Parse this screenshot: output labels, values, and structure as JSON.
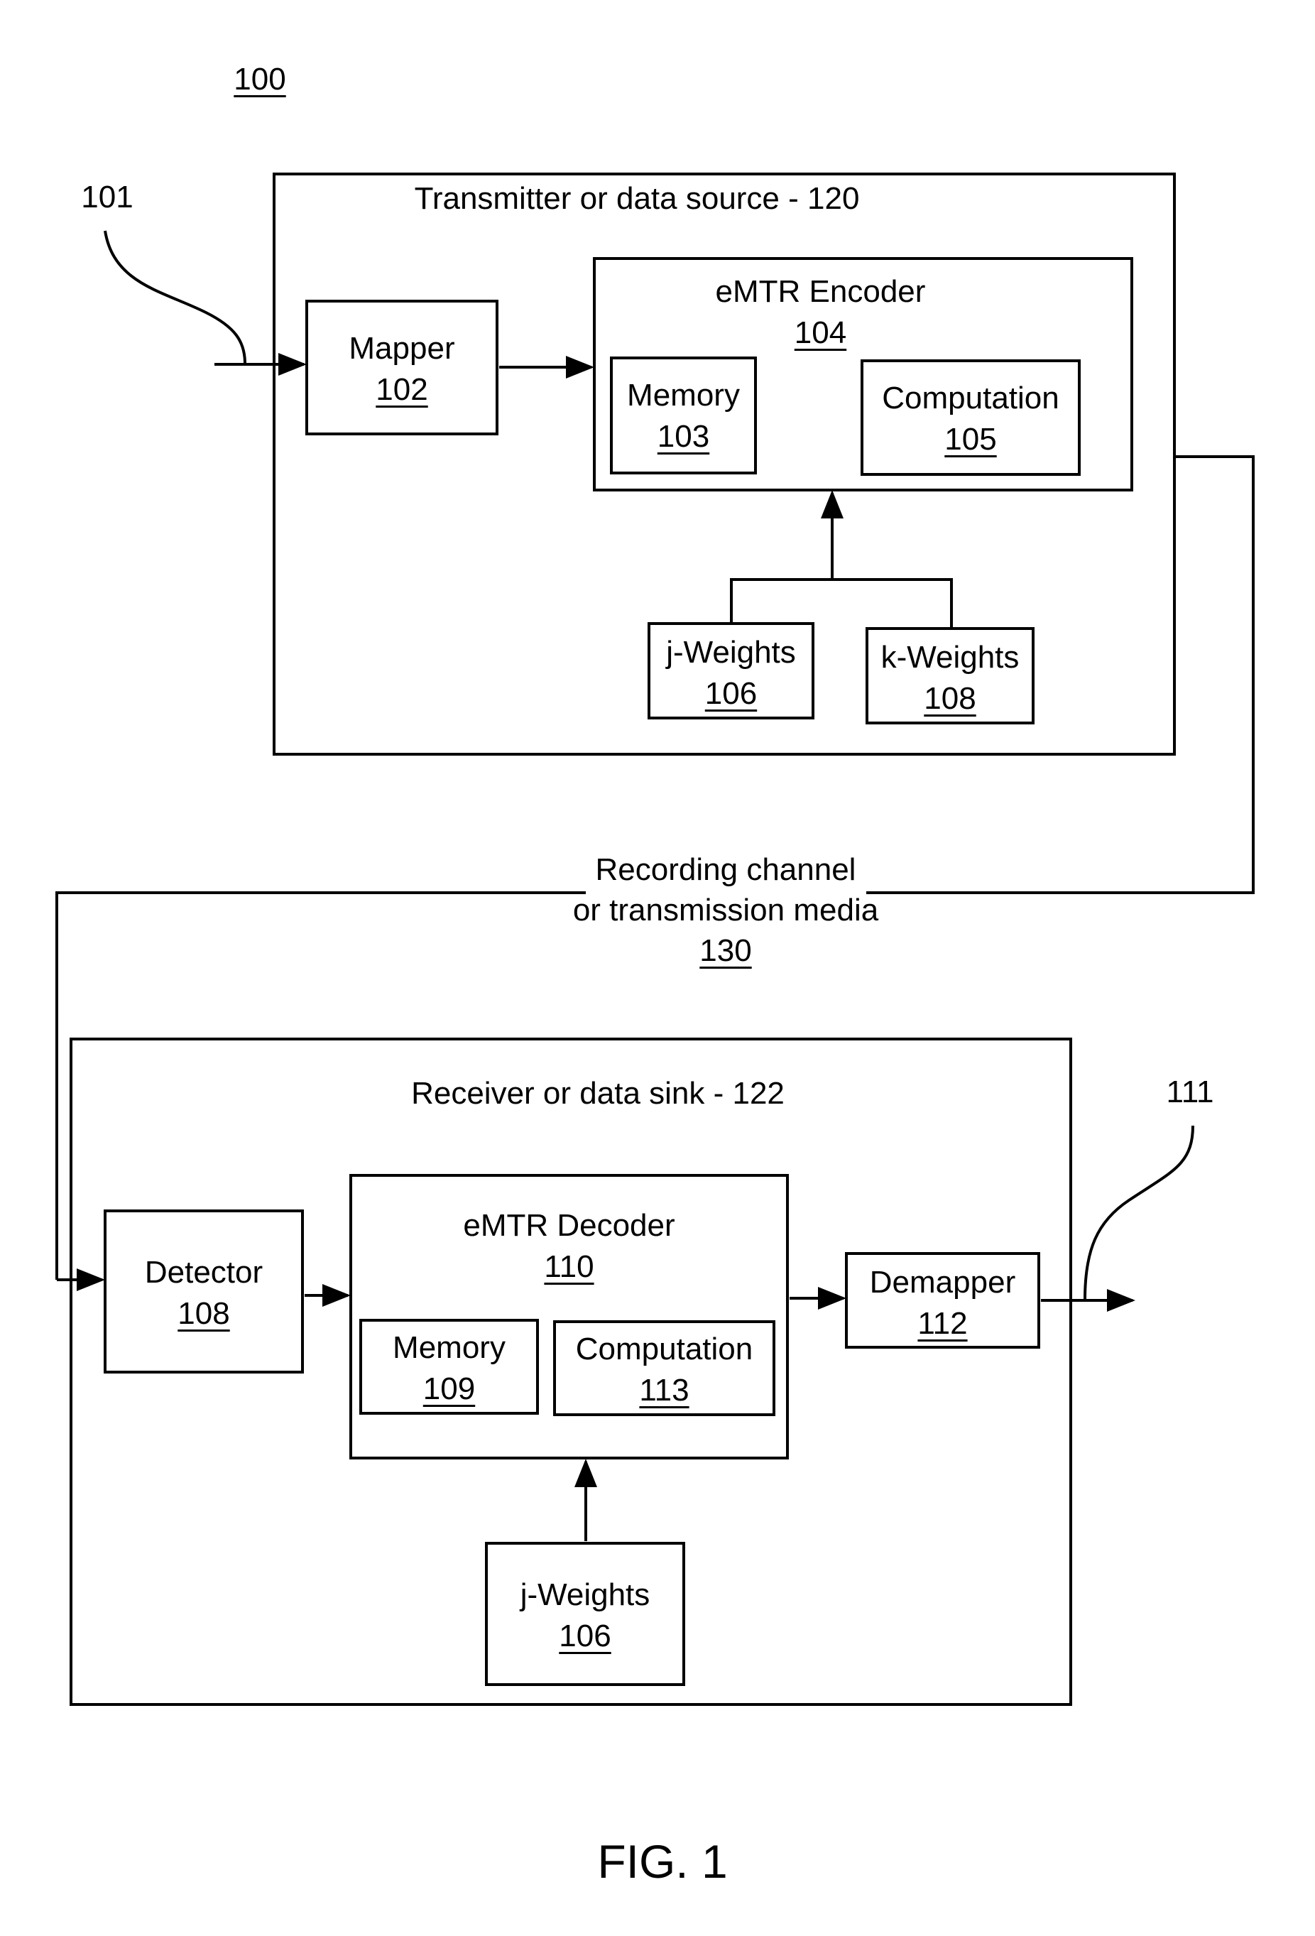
{
  "figure": {
    "ref": "100",
    "caption": "FIG. 1",
    "input_ref": "101",
    "output_ref": "111"
  },
  "transmitter": {
    "title": "Transmitter or data source - 120",
    "mapper": {
      "name": "Mapper",
      "ref": "102"
    },
    "encoder": {
      "name": "eMTR Encoder",
      "ref": "104",
      "memory": {
        "name": "Memory",
        "ref": "103"
      },
      "computation": {
        "name": "Computation",
        "ref": "105"
      }
    },
    "j_weights": {
      "name": "j-Weights",
      "ref": "106"
    },
    "k_weights": {
      "name": "k-Weights",
      "ref": "108"
    }
  },
  "channel": {
    "line1": "Recording channel",
    "line2": "or transmission media",
    "ref": "130"
  },
  "receiver": {
    "title": "Receiver or data sink - 122",
    "detector": {
      "name": "Detector",
      "ref": "108"
    },
    "decoder": {
      "name": "eMTR Decoder",
      "ref": "110",
      "memory": {
        "name": "Memory",
        "ref": "109"
      },
      "computation": {
        "name": "Computation",
        "ref": "113"
      }
    },
    "demapper": {
      "name": "Demapper",
      "ref": "112"
    },
    "j_weights": {
      "name": "j-Weights",
      "ref": "106"
    }
  }
}
